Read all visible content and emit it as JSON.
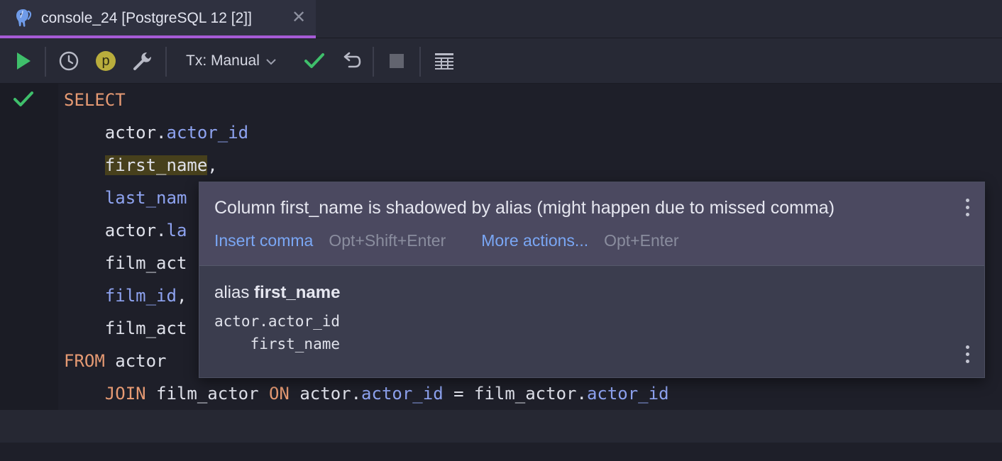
{
  "tab": {
    "title": "console_24 [PostgreSQL 12 [2]]",
    "icon": "postgresql-elephant-icon",
    "close_glyph": "✕"
  },
  "toolbar": {
    "tx_mode_label": "Tx: Manual",
    "profile_badge": "p"
  },
  "editor": {
    "lines": [
      {
        "indent": "",
        "tokens": [
          {
            "t": "kw",
            "v": "SELECT"
          }
        ]
      },
      {
        "indent": "    ",
        "tokens": [
          {
            "t": "id",
            "v": "actor."
          },
          {
            "t": "col",
            "v": "actor_id"
          }
        ]
      },
      {
        "indent": "    ",
        "tokens": [
          {
            "t": "hl",
            "v": "first_name"
          },
          {
            "t": "id",
            "v": ","
          }
        ]
      },
      {
        "indent": "    ",
        "tokens": [
          {
            "t": "col",
            "v": "last_nam"
          }
        ]
      },
      {
        "indent": "    ",
        "tokens": [
          {
            "t": "id",
            "v": "actor."
          },
          {
            "t": "col",
            "v": "la"
          }
        ]
      },
      {
        "indent": "    ",
        "tokens": [
          {
            "t": "id",
            "v": "film_act"
          }
        ]
      },
      {
        "indent": "    ",
        "tokens": [
          {
            "t": "col",
            "v": "film_id"
          },
          {
            "t": "id",
            "v": ","
          }
        ]
      },
      {
        "indent": "    ",
        "tokens": [
          {
            "t": "id",
            "v": "film_act"
          }
        ]
      },
      {
        "indent": "",
        "tokens": [
          {
            "t": "kw",
            "v": "FROM"
          },
          {
            "t": "id",
            "v": " actor"
          }
        ]
      },
      {
        "indent": "    ",
        "tokens": [
          {
            "t": "kw",
            "v": "JOIN"
          },
          {
            "t": "id",
            "v": " film_actor "
          },
          {
            "t": "kw",
            "v": "ON"
          },
          {
            "t": "id",
            "v": " actor."
          },
          {
            "t": "col",
            "v": "actor_id"
          },
          {
            "t": "id",
            "v": " = film_actor."
          },
          {
            "t": "col",
            "v": "actor_id"
          }
        ]
      }
    ]
  },
  "popup": {
    "message": "Column first_name is shadowed by alias (might happen due to missed comma)",
    "primary_action": "Insert comma",
    "primary_shortcut": "Opt+Shift+Enter",
    "more_action": "More actions...",
    "more_shortcut": "Opt+Enter",
    "body_title_prefix": "alias ",
    "body_title_name": "first_name",
    "code_line_1": "actor.actor_id",
    "code_line_2": "    first_name"
  },
  "colors": {
    "accent_tab": "#a65bd6",
    "keyword": "#e69a73",
    "column": "#8ea3f0",
    "run_green": "#3fbf6b",
    "link": "#7aa7f5"
  }
}
